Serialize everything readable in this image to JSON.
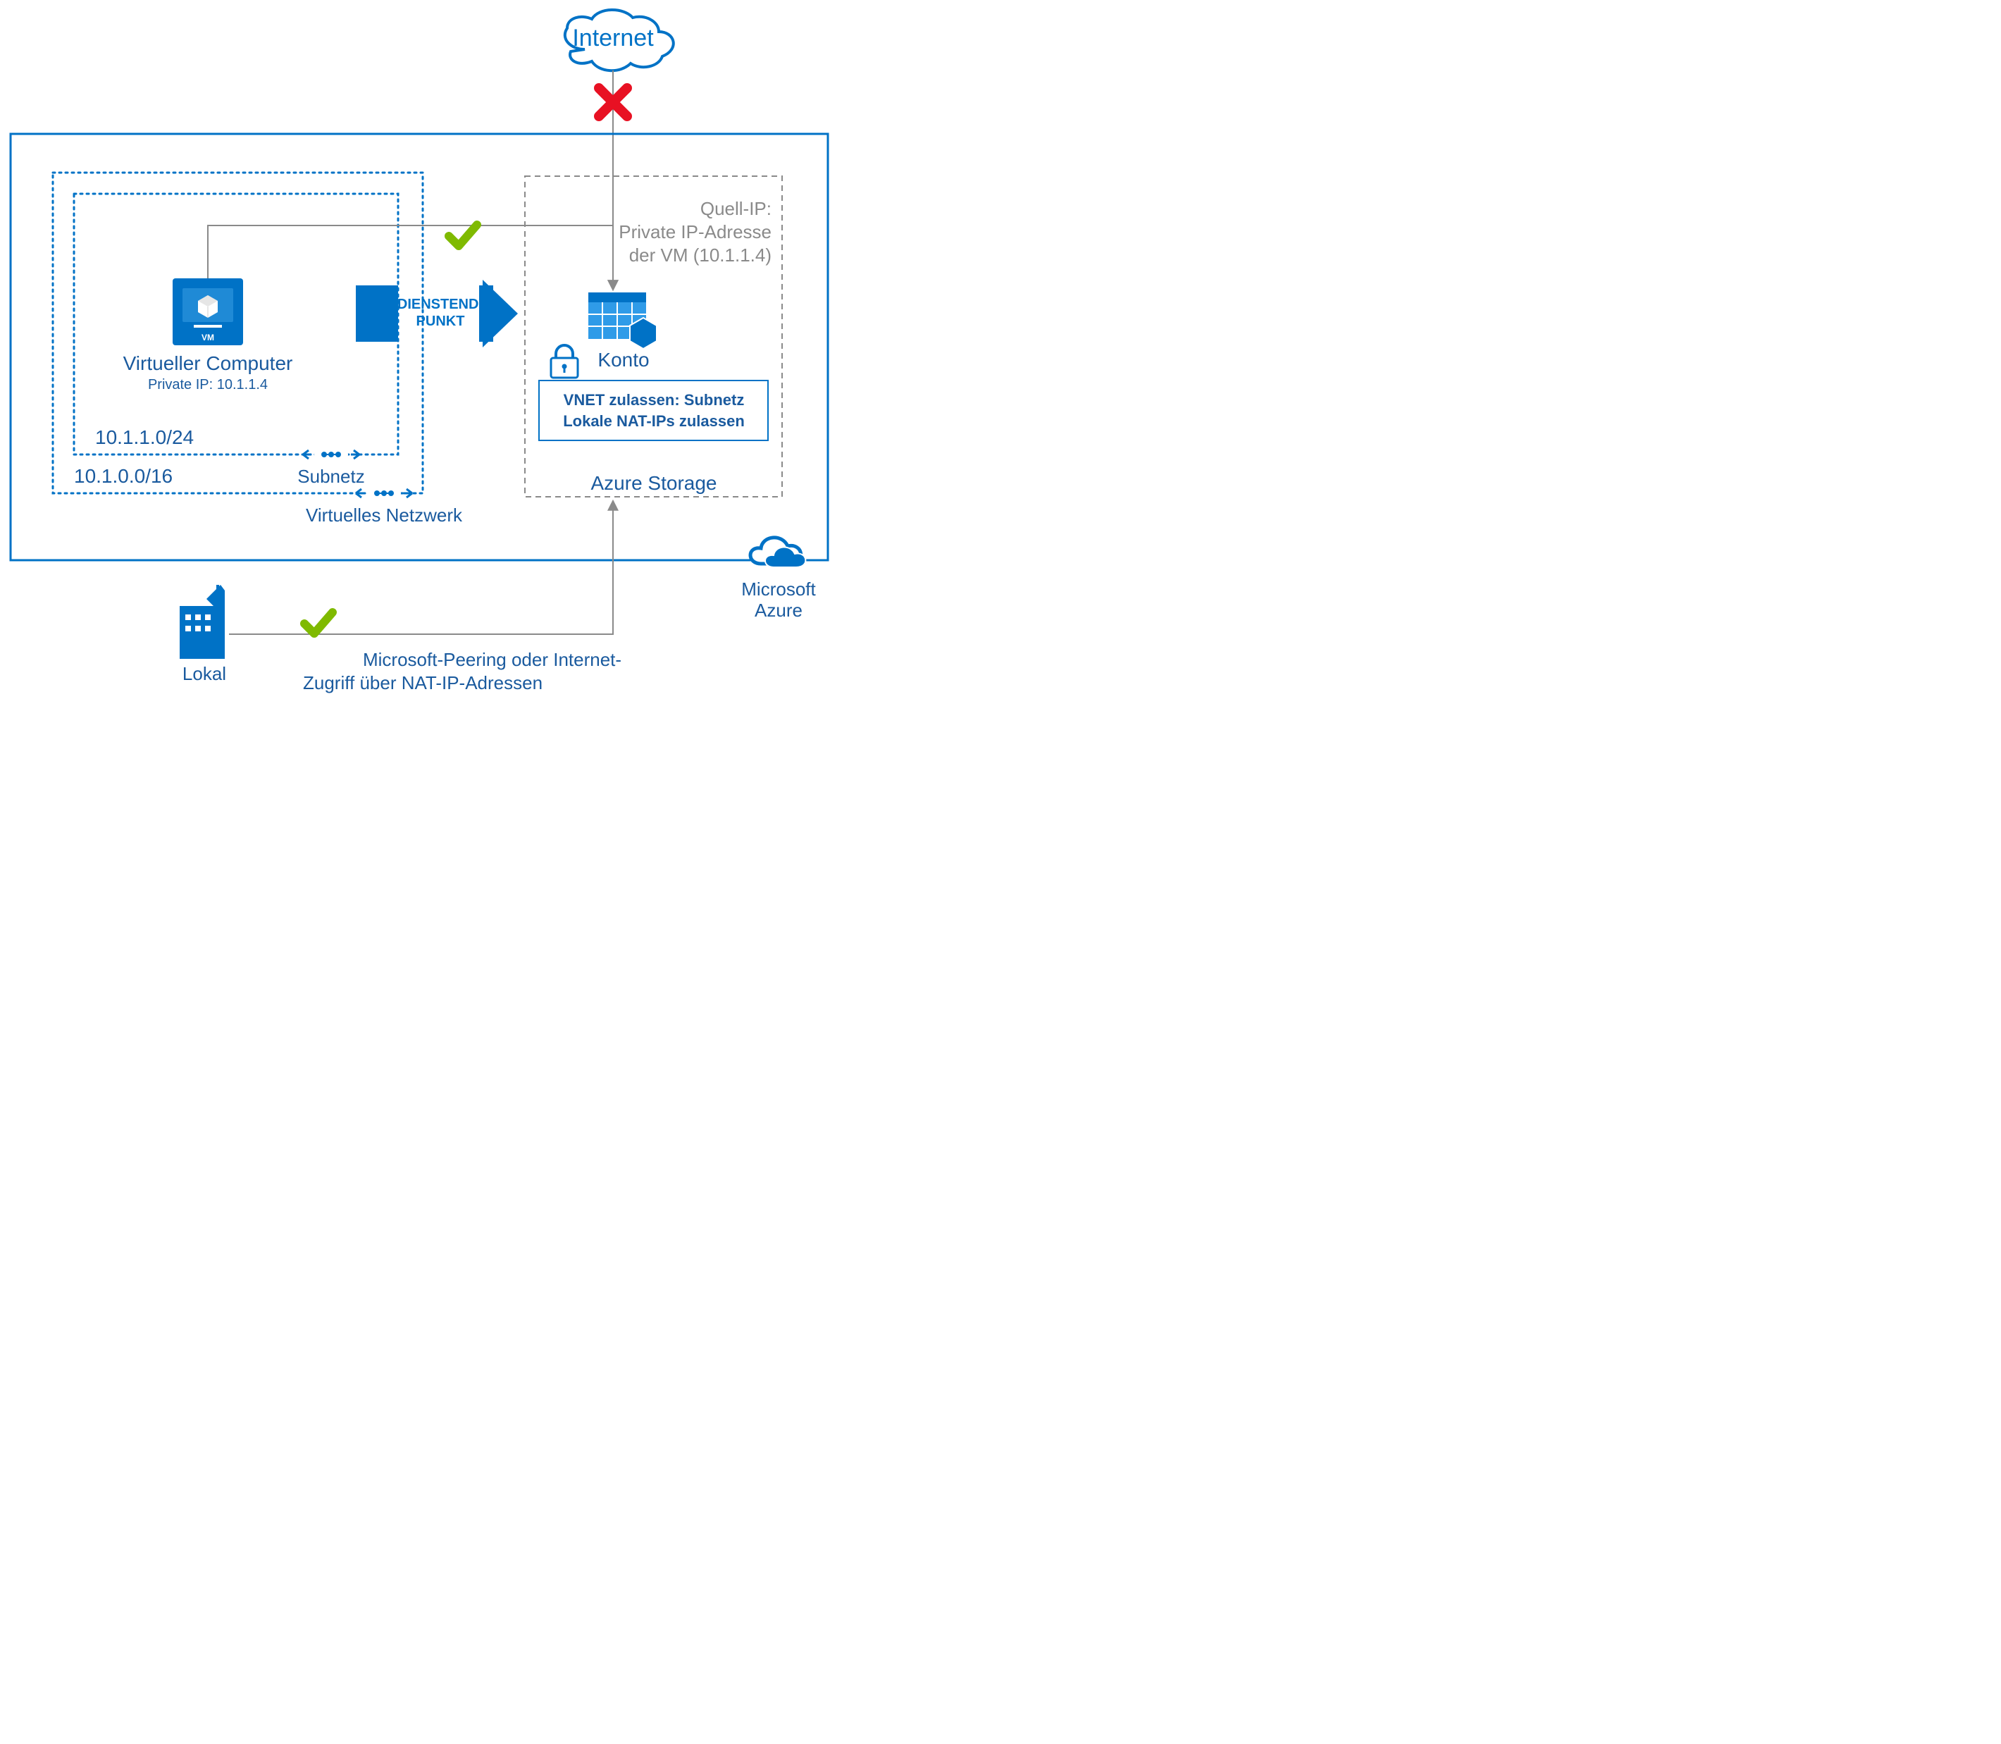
{
  "internet_label": "Internet",
  "vm_title": "Virtueller Computer",
  "vm_subtitle": "Private IP: 10.1.1.4",
  "subnet_cidr": "10.1.1.0/24",
  "vnet_cidr": "10.1.0.0/16",
  "subnet_label": "Subnetz",
  "vnet_label": "Virtuelles Netzwerk",
  "service_endpoint_line1": "DIENSTEND-",
  "service_endpoint_line2": "PUNKT",
  "source_ip_line1": "Quell-IP:",
  "source_ip_line2": "Private IP-Adresse",
  "source_ip_line3": "der VM (10.1.1.4)",
  "account_label": "Konto",
  "allow_line1": "VNET zulassen: Subnetz",
  "allow_line2": "Lokale NAT-IPs zulassen",
  "storage_label": "Azure Storage",
  "azure_line1": "Microsoft",
  "azure_line2": "Azure",
  "onprem_label": "Lokal",
  "peering_line1": "Microsoft-Peering oder Internet-",
  "peering_line2": "Zugriff über NAT-IP-Adressen",
  "vm_badge": "VM",
  "colors": {
    "azure_blue": "#0072c6",
    "text_blue": "#1a5a9e",
    "grey": "#8a8a8a",
    "green": "#7fba00",
    "red": "#e81123"
  }
}
